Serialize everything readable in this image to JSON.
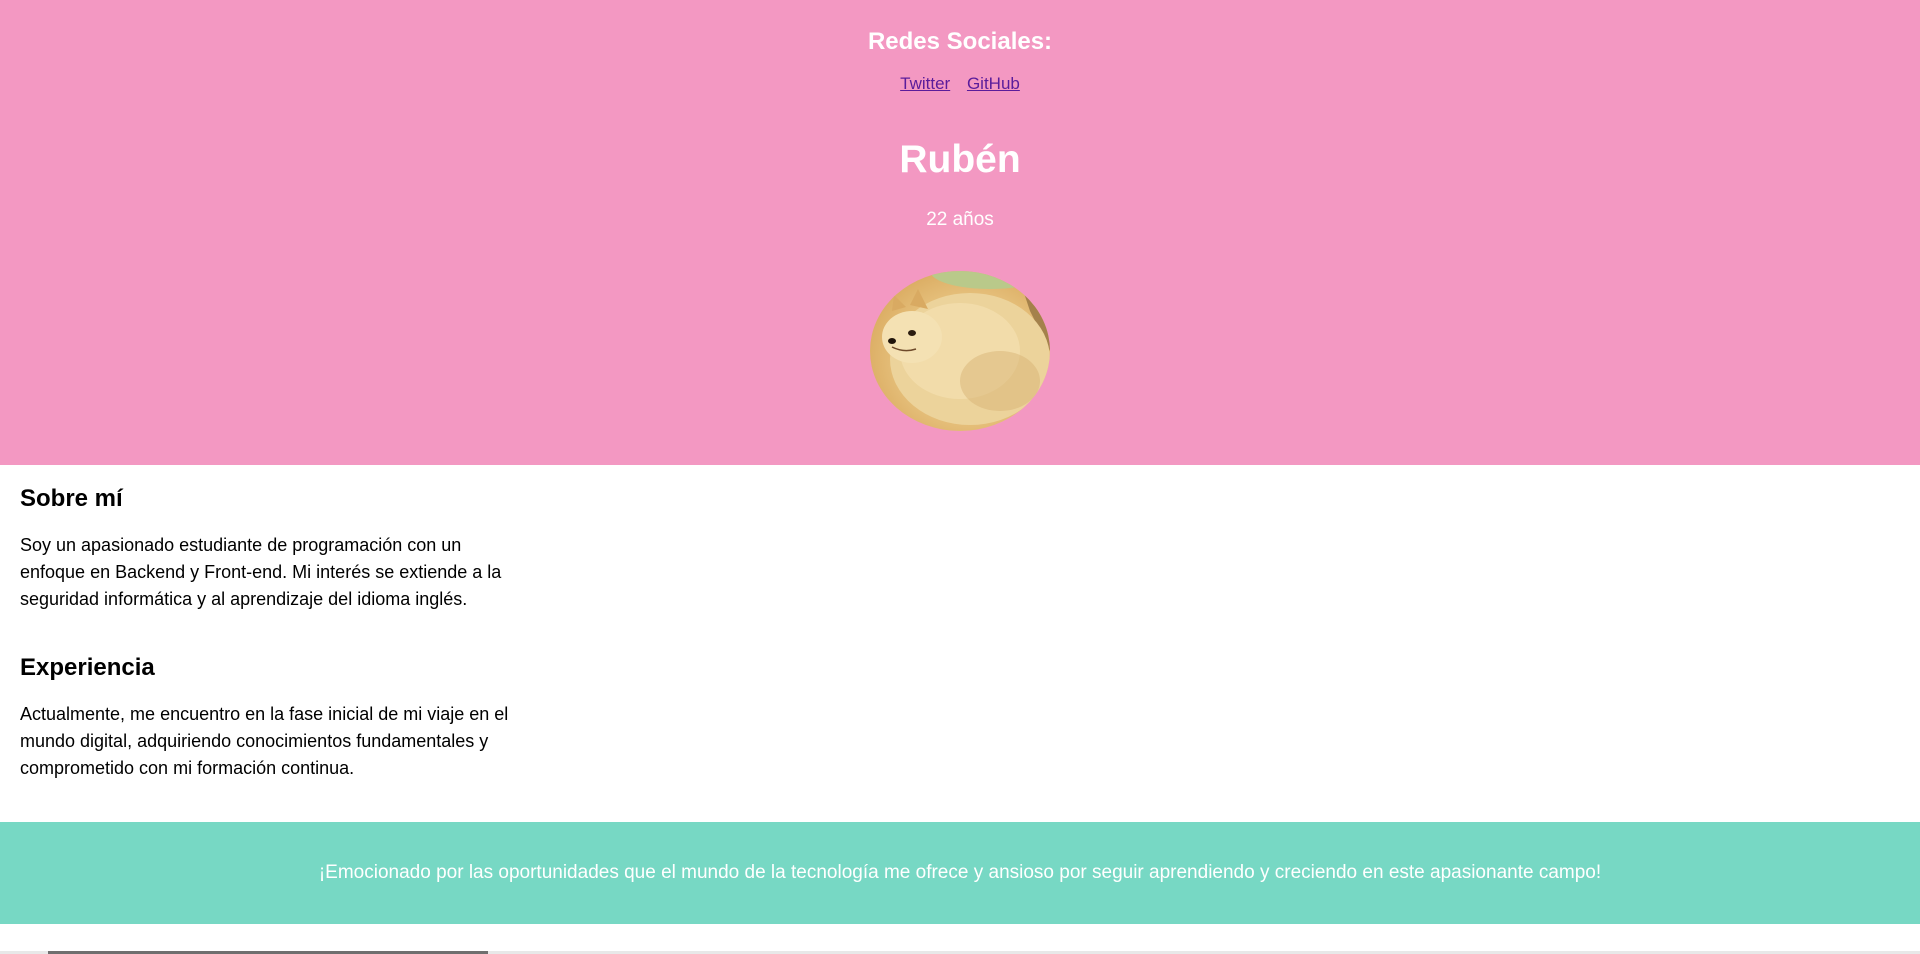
{
  "header": {
    "social_title": "Redes Sociales:",
    "links": [
      {
        "label": "Twitter"
      },
      {
        "label": "GitHub"
      }
    ],
    "name": "Rubén",
    "age": "22 años",
    "avatar_icon": "doge-avatar-image"
  },
  "about": {
    "title": "Sobre mí",
    "text": "Soy un apasionado estudiante de programación con un enfoque en Backend y Front-end. Mi interés se extiende a la seguridad informática y al aprendizaje del idioma inglés."
  },
  "experience": {
    "title": "Experiencia",
    "text": "Actualmente, me encuentro en la fase inicial de mi viaje en el mundo digital, adquiriendo conocimientos fundamentales y comprometido con mi formación continua."
  },
  "footer": {
    "text": "¡Emocionado por las oportunidades que el mundo de la tecnología me ofrece y ansioso por seguir aprendiendo y creciendo en este apasionante campo!"
  },
  "colors": {
    "header_bg": "#f398c2",
    "footer_bg": "#77d8c4",
    "link": "#5a1c9b"
  }
}
